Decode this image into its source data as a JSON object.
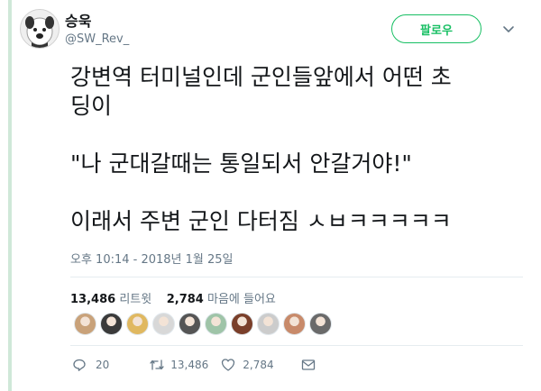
{
  "user": {
    "name": "승욱",
    "handle": "@SW_Rev_"
  },
  "follow_label": "팔로우",
  "tweet": {
    "lines": [
      "강변역 터미널인데 군인들앞에서 어떤 초",
      "딩이",
      "",
      "\"나 군대갈때는 통일되서 안갈거야!\"",
      "",
      "이래서 주변 군인 다터짐 ㅅㅂㅋㅋㅋㅋㅋ"
    ]
  },
  "timestamp": "오후 10:14 - 2018년 1월 25일",
  "stats": {
    "retweets_count": "13,486",
    "retweets_label": "리트윗",
    "likes_count": "2,784",
    "likes_label": "마음에 들어요"
  },
  "likers": [
    {
      "color": "#c9a27a"
    },
    {
      "color": "#3a3a3a"
    },
    {
      "color": "#e0b860"
    },
    {
      "color": "#d8d8d8"
    },
    {
      "color": "#555555"
    },
    {
      "color": "#9fc4a8"
    },
    {
      "color": "#7a3f2a"
    },
    {
      "color": "#cccccc"
    },
    {
      "color": "#c88a6a"
    },
    {
      "color": "#6a6a6a"
    }
  ],
  "actions": {
    "replies": "20",
    "retweets": "13,486",
    "likes": "2,784"
  },
  "colors": {
    "accent_green": "#17bf63",
    "muted": "#657786",
    "text": "#14171a"
  },
  "icons": [
    "reply-icon",
    "retweet-icon",
    "heart-icon",
    "message-icon",
    "chevron-down-icon"
  ]
}
